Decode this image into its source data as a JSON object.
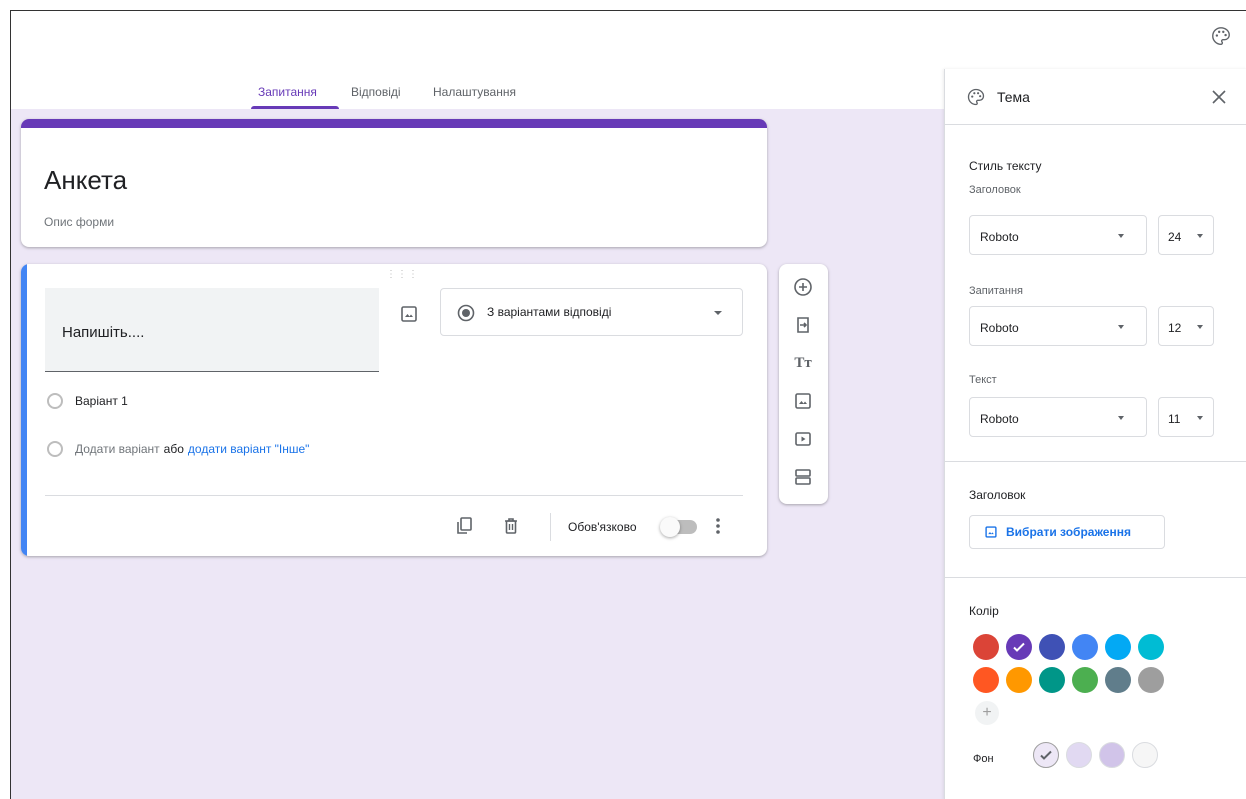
{
  "tabs": [
    {
      "label": "Запитання",
      "active": true
    },
    {
      "label": "Відповіді",
      "active": false
    },
    {
      "label": "Налаштування",
      "active": false
    }
  ],
  "form": {
    "title": "Анкета",
    "description": "Опис форми"
  },
  "question": {
    "placeholder": "Напишіть....",
    "type_label": "З варіантами відповіді",
    "option1": "Варіант 1",
    "add_option": "Додати варіант",
    "or_word": "або",
    "add_other": "додати варіант \"Інше\"",
    "required_label": "Обов'язково",
    "required": false
  },
  "toolbar": {
    "icons": [
      "add-circle-icon",
      "import-icon",
      "title-icon",
      "image-icon",
      "video-icon",
      "section-icon"
    ],
    "title_glyph": "Tт"
  },
  "theme_panel": {
    "title": "Тема",
    "text_style_title": "Стиль тексту",
    "header_label": "Заголовок",
    "header_font": "Roboto",
    "header_size": "24",
    "question_label": "Запитання",
    "question_font": "Roboto",
    "question_size": "12",
    "text_label": "Текст",
    "text_font": "Roboto",
    "text_size": "11",
    "header_image_title": "Заголовок",
    "choose_image": "Вибрати зображення",
    "color_title": "Колір",
    "add_color": "+",
    "background_label": "Фон"
  },
  "colors": {
    "accent": "#673ab7",
    "swatches": [
      "#db4437",
      "#673ab7",
      "#3f51b5",
      "#4285f4",
      "#03a9f4",
      "#00bcd4",
      "#ff5722",
      "#ff9800",
      "#009688",
      "#4caf50",
      "#607d8b",
      "#9e9e9e"
    ],
    "selected_swatch": 1,
    "backgrounds": [
      "#ede7f6",
      "#e1d9f2",
      "#d1c4e9",
      "#f6f6f6"
    ],
    "selected_background": 0
  }
}
